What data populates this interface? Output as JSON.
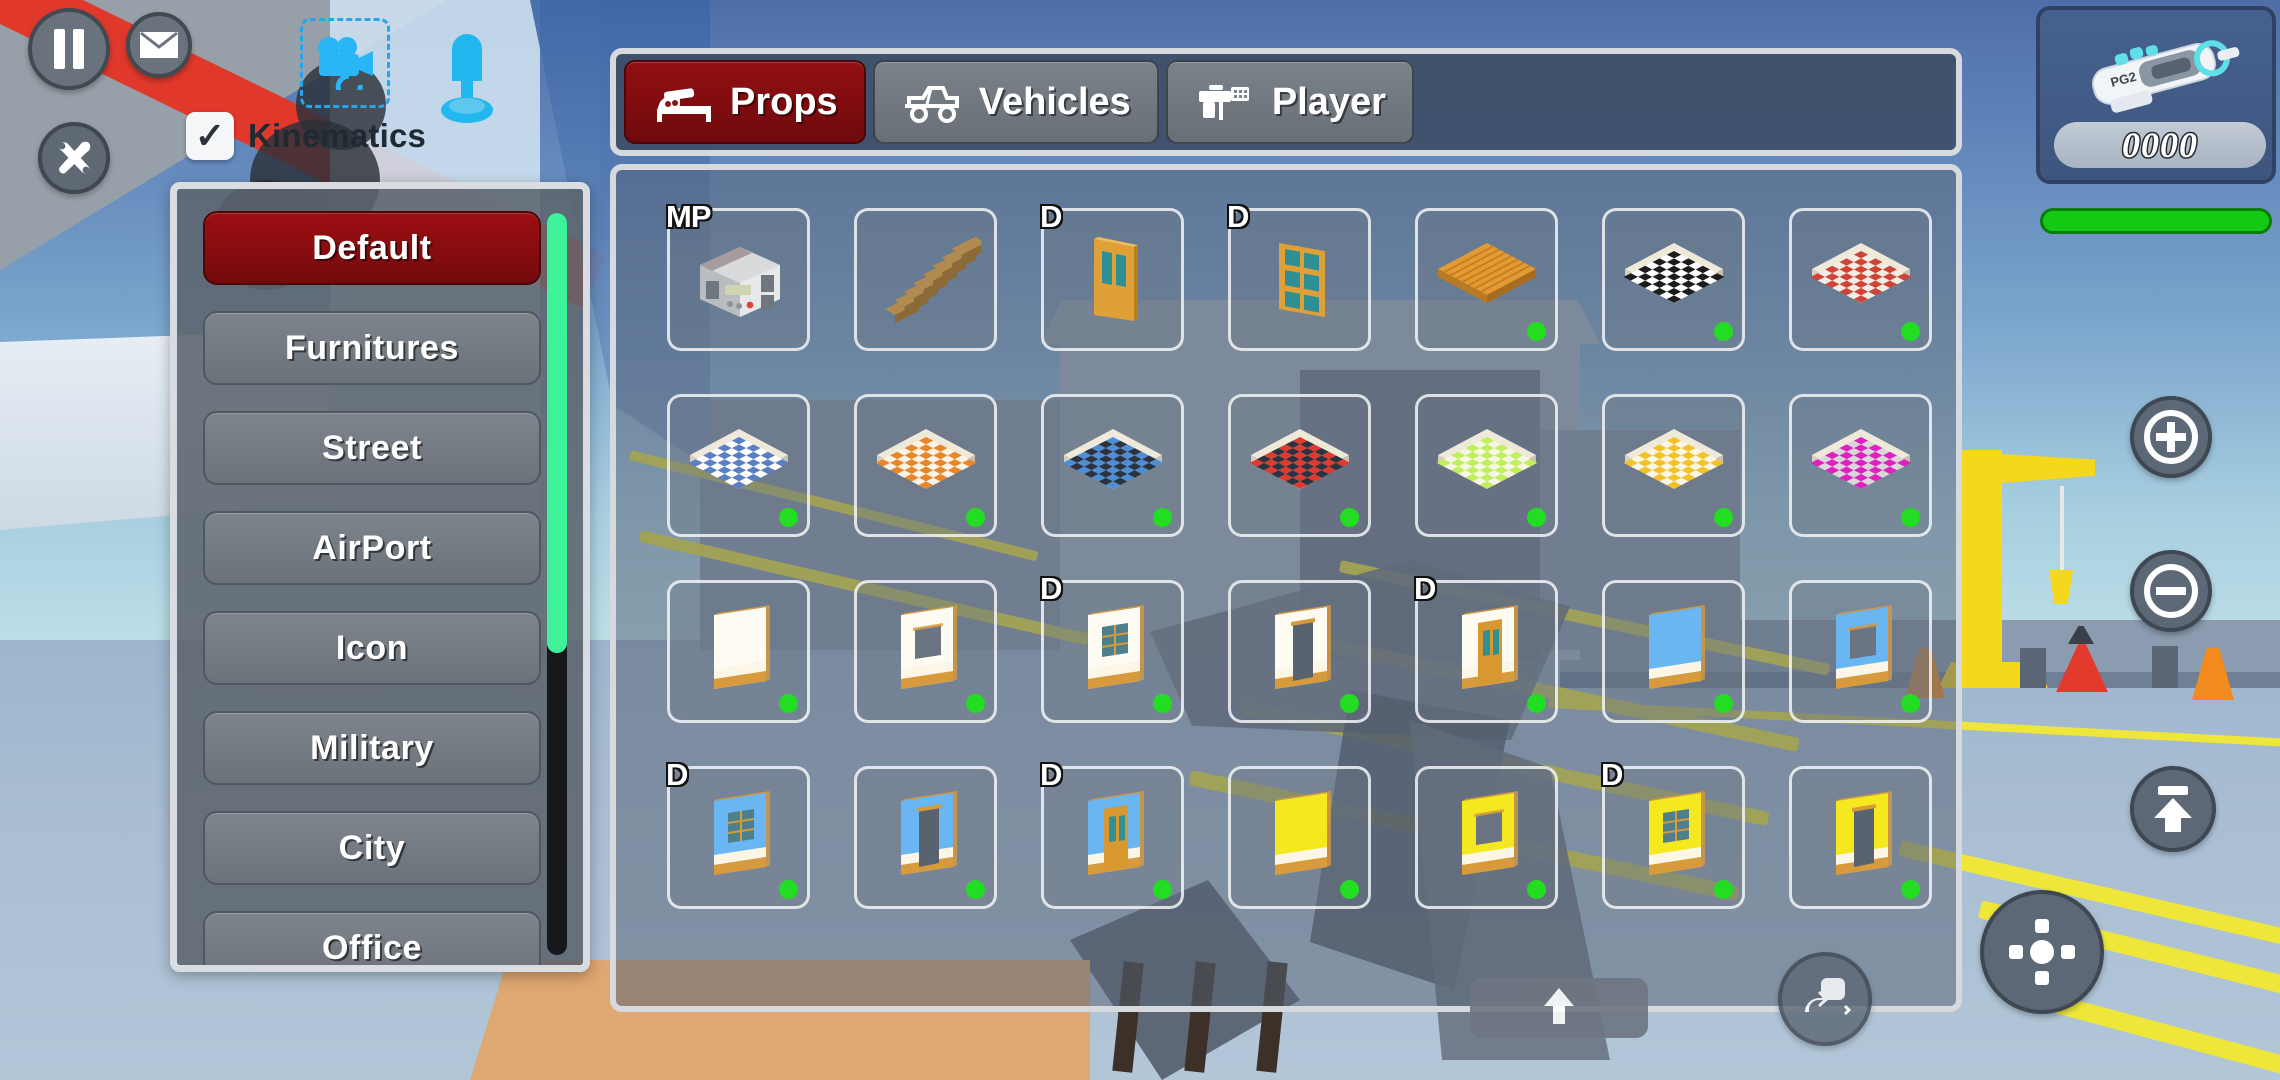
{
  "hud": {
    "pause_label": "pause-icon",
    "mail_label": "envelope-icon",
    "tools_label": "tools-icon",
    "trash_label": "trash-icon",
    "zoom_in_label": "plus-icon",
    "zoom_out_label": "minus-icon",
    "jump_label": "up-arrow-icon",
    "dpad_label": "dpad-icon",
    "rotate_label": "rotate-icon",
    "raise_label": "up-arrow-icon",
    "camera_tool_label": "camera-icon",
    "player_tool_label": "player-icon",
    "kinematics": {
      "label": "Kinematics",
      "checked": true,
      "check_glyph": "✓"
    }
  },
  "weapon": {
    "name": "PG2",
    "ammo": "0000",
    "health_percent": 100,
    "health_color": "#14c914"
  },
  "categories": {
    "selected": "Default",
    "scroll_thumb_color": "#3ef29a",
    "items": [
      {
        "label": "Default",
        "active": true
      },
      {
        "label": "Furnitures",
        "active": false
      },
      {
        "label": "Street",
        "active": false
      },
      {
        "label": "AirPort",
        "active": false
      },
      {
        "label": "Icon",
        "active": false
      },
      {
        "label": "Military",
        "active": false
      },
      {
        "label": "City",
        "active": false
      },
      {
        "label": "Office",
        "active": false
      }
    ]
  },
  "tabs": {
    "active": "Props",
    "items": [
      {
        "label": "Props",
        "icon": "bed-icon",
        "active": true
      },
      {
        "label": "Vehicles",
        "icon": "jeep-icon",
        "active": false
      },
      {
        "label": "Player",
        "icon": "gun-icon",
        "active": false
      }
    ]
  },
  "grid": {
    "columns": 7,
    "rows": 4,
    "accent_selected": "#8f0f12",
    "dot_color": "#22dd22",
    "items": [
      {
        "name": "boombox",
        "badge": "MP",
        "dot": false,
        "thumb": "boombox"
      },
      {
        "name": "wooden-stairs",
        "badge": "",
        "dot": false,
        "thumb": "stairs"
      },
      {
        "name": "wooden-door",
        "badge": "D",
        "dot": false,
        "thumb": "door-wood"
      },
      {
        "name": "wooden-window",
        "badge": "D",
        "dot": false,
        "thumb": "window-grid"
      },
      {
        "name": "wood-plank-floor",
        "badge": "",
        "dot": true,
        "thumb": "floor-plank"
      },
      {
        "name": "checker-floor-black",
        "badge": "",
        "dot": true,
        "thumb": "floor-checker",
        "c1": "#1c1c1c",
        "c2": "#ffffff"
      },
      {
        "name": "checker-floor-red",
        "badge": "",
        "dot": true,
        "thumb": "floor-checker",
        "c1": "#cf4338",
        "c2": "#f3ece0"
      },
      {
        "name": "checker-floor-blue-light",
        "badge": "",
        "dot": true,
        "thumb": "floor-checker",
        "c1": "#5b7fc4",
        "c2": "#ffffff"
      },
      {
        "name": "checker-floor-orange",
        "badge": "",
        "dot": true,
        "thumb": "floor-checker",
        "c1": "#e8862a",
        "c2": "#fbf3e6"
      },
      {
        "name": "checker-floor-blue-dark",
        "badge": "",
        "dot": true,
        "thumb": "floor-checker",
        "c1": "#4e8ed6",
        "c2": "#2b3340"
      },
      {
        "name": "checker-floor-red-dark",
        "badge": "",
        "dot": true,
        "thumb": "floor-checker",
        "c1": "#e03a30",
        "c2": "#2b3340"
      },
      {
        "name": "checker-floor-green",
        "badge": "",
        "dot": true,
        "thumb": "floor-checker",
        "c1": "#bdf05a",
        "c2": "#f6f6e2"
      },
      {
        "name": "checker-floor-yellow",
        "badge": "",
        "dot": true,
        "thumb": "floor-checker",
        "c1": "#f2c327",
        "c2": "#fbf5e4"
      },
      {
        "name": "checker-floor-magenta",
        "badge": "",
        "dot": true,
        "thumb": "floor-checker",
        "c1": "#e020c0",
        "c2": "#d8d8d8"
      },
      {
        "name": "wall-plain-white",
        "badge": "",
        "dot": true,
        "thumb": "wall",
        "wall": "#fdfbf2",
        "trim": "#d79a3d",
        "hole": "none"
      },
      {
        "name": "wall-white-opening",
        "badge": "",
        "dot": true,
        "thumb": "wall",
        "wall": "#fdfbf2",
        "trim": "#d79a3d",
        "hole": "square"
      },
      {
        "name": "wall-white-window",
        "badge": "D",
        "dot": true,
        "thumb": "wall",
        "wall": "#fdfbf2",
        "trim": "#d79a3d",
        "hole": "window"
      },
      {
        "name": "wall-white-doorway",
        "badge": "",
        "dot": true,
        "thumb": "wall",
        "wall": "#fdfbf2",
        "trim": "#d79a3d",
        "hole": "door"
      },
      {
        "name": "wall-white-wood-door",
        "badge": "D",
        "dot": true,
        "thumb": "wall",
        "wall": "#fdfbf2",
        "trim": "#d79a3d",
        "hole": "wooddoor"
      },
      {
        "name": "wall-blue-glass",
        "badge": "",
        "dot": true,
        "thumb": "wall",
        "wall": "#6ab6f2",
        "trim": "#d79a3d",
        "hole": "none"
      },
      {
        "name": "wall-blue-opening",
        "badge": "",
        "dot": true,
        "thumb": "wall",
        "wall": "#6ab6f2",
        "trim": "#d79a3d",
        "hole": "square"
      },
      {
        "name": "wall-blue-window",
        "badge": "D",
        "dot": true,
        "thumb": "wall",
        "wall": "#6ab6f2",
        "trim": "#d79a3d",
        "hole": "window"
      },
      {
        "name": "wall-blue-doorway",
        "badge": "",
        "dot": true,
        "thumb": "wall",
        "wall": "#6ab6f2",
        "trim": "#d79a3d",
        "hole": "door"
      },
      {
        "name": "wall-blue-wood-door",
        "badge": "D",
        "dot": true,
        "thumb": "wall",
        "wall": "#6ab6f2",
        "trim": "#d79a3d",
        "hole": "wooddoor"
      },
      {
        "name": "wall-yellow-plain",
        "badge": "",
        "dot": true,
        "thumb": "wall",
        "wall": "#f6e81f",
        "trim": "#d79a3d",
        "hole": "none"
      },
      {
        "name": "wall-yellow-opening",
        "badge": "",
        "dot": true,
        "thumb": "wall",
        "wall": "#f6e81f",
        "trim": "#d79a3d",
        "hole": "square"
      },
      {
        "name": "wall-yellow-window",
        "badge": "D",
        "dot": true,
        "thumb": "wall",
        "wall": "#f6e81f",
        "trim": "#d79a3d",
        "hole": "window"
      },
      {
        "name": "wall-yellow-doorway",
        "badge": "",
        "dot": true,
        "thumb": "wall",
        "wall": "#f6e81f",
        "trim": "#d79a3d",
        "hole": "door"
      }
    ]
  }
}
